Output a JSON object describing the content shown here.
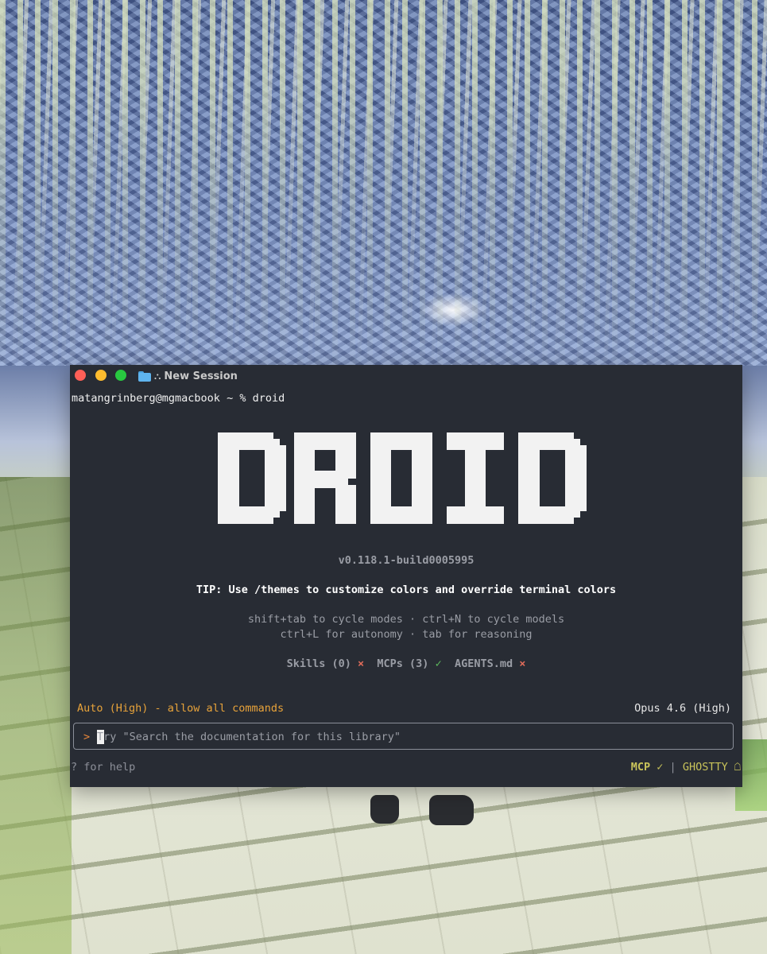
{
  "window": {
    "title": "New Session",
    "title_icon": "folder-icon",
    "secondary_icon": "nodes-icon",
    "traffic_lights": {
      "close": "#ff5f57",
      "minimize": "#febc2e",
      "zoom": "#28c840"
    }
  },
  "terminal": {
    "prompt_line": "matangrinberg@mgmacbook ~ % droid",
    "logo_text": "DROID",
    "version": "v0.118.1-build0005995",
    "tip": "TIP: Use /themes to customize colors and override terminal colors",
    "help_line_1": "shift+tab to cycle modes · ctrl+N to cycle models",
    "help_line_2": "ctrl+L for autonomy · tab for reasoning",
    "status": {
      "skills_label": "Skills (0)",
      "skills_mark": "×",
      "mcps_label": "MCPs (3)",
      "mcps_mark": "✓",
      "agents_label": "AGENTS.md",
      "agents_mark": "×"
    },
    "mode": "Auto (High) - allow all commands",
    "model": "Opus 4.6 (High)",
    "input": {
      "prompt_symbol": ">",
      "value": "",
      "placeholder": "Try \"Search the documentation for this library\""
    },
    "footer": {
      "help": "? for help",
      "mcp_status": "MCP ✓",
      "separator": "|",
      "terminal_name": "GHOSTTY",
      "bell_icon": "bell-icon"
    }
  },
  "colors": {
    "terminal_bg": "#282c34",
    "mode_orange": "#e8a33a",
    "prompt_orange": "#e8873a",
    "error_red": "#e06c5a",
    "ok_green": "#5fbf5f",
    "footer_yellow": "#c9c45a"
  }
}
